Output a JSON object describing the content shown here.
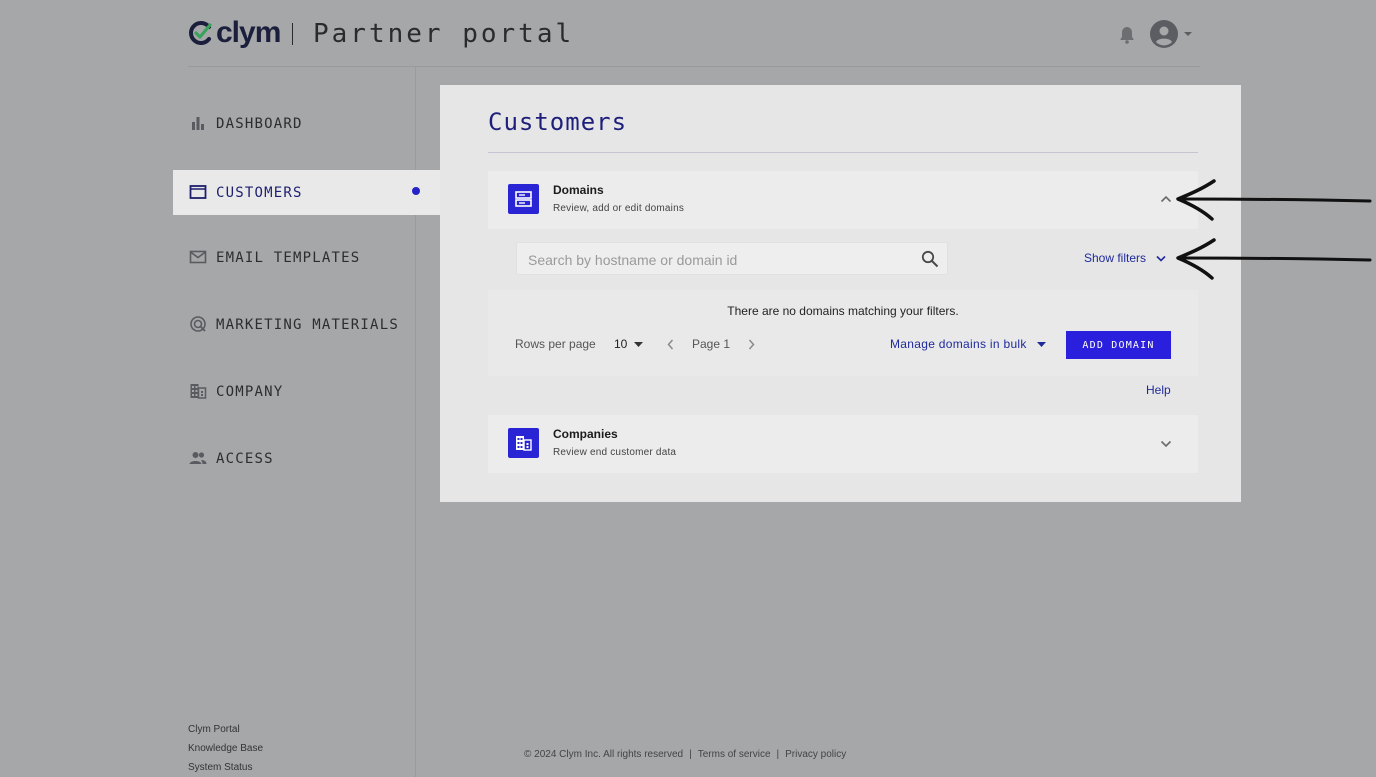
{
  "header": {
    "brand": "clym",
    "portal_title": "Partner portal",
    "icons": {
      "notifications": "bell-icon",
      "account": "avatar-icon",
      "account_menu": "caret-down-icon"
    }
  },
  "sidebar": {
    "items": [
      {
        "label": "DASHBOARD",
        "icon": "bar-chart-icon",
        "active": false
      },
      {
        "label": "CUSTOMERS",
        "icon": "folder-icon",
        "active": true
      },
      {
        "label": "EMAIL TEMPLATES",
        "icon": "mail-icon",
        "active": false
      },
      {
        "label": "MARKETING MATERIALS",
        "icon": "target-icon",
        "active": false
      },
      {
        "label": "COMPANY",
        "icon": "building-icon",
        "active": false
      },
      {
        "label": "ACCESS",
        "icon": "people-icon",
        "active": false
      }
    ],
    "footer_links": [
      "Clym Portal",
      "Knowledge Base",
      "System Status"
    ]
  },
  "main": {
    "title": "Customers",
    "domains_panel": {
      "title": "Domains",
      "subtitle": "Review, add or edit domains",
      "expanded": true,
      "search_placeholder": "Search by hostname or domain id",
      "show_filters_label": "Show filters",
      "empty_message": "There are no domains matching your filters.",
      "rows_per_page_label": "Rows per page",
      "rows_per_page_value": "10",
      "page_label": "Page 1",
      "bulk_label": "Manage domains in bulk",
      "add_button_label": "ADD DOMAIN",
      "help_label": "Help"
    },
    "companies_panel": {
      "title": "Companies",
      "subtitle": "Review end customer data",
      "expanded": false
    }
  },
  "footer": {
    "copyright": "© 2024 Clym Inc. All rights reserved",
    "separator": "|",
    "terms": "Terms of service",
    "privacy": "Privacy policy"
  },
  "colors": {
    "accent": "#2a1fdc",
    "link": "#1f2a9a",
    "background": "#a6a7a9",
    "card": "#e6e6e7"
  }
}
